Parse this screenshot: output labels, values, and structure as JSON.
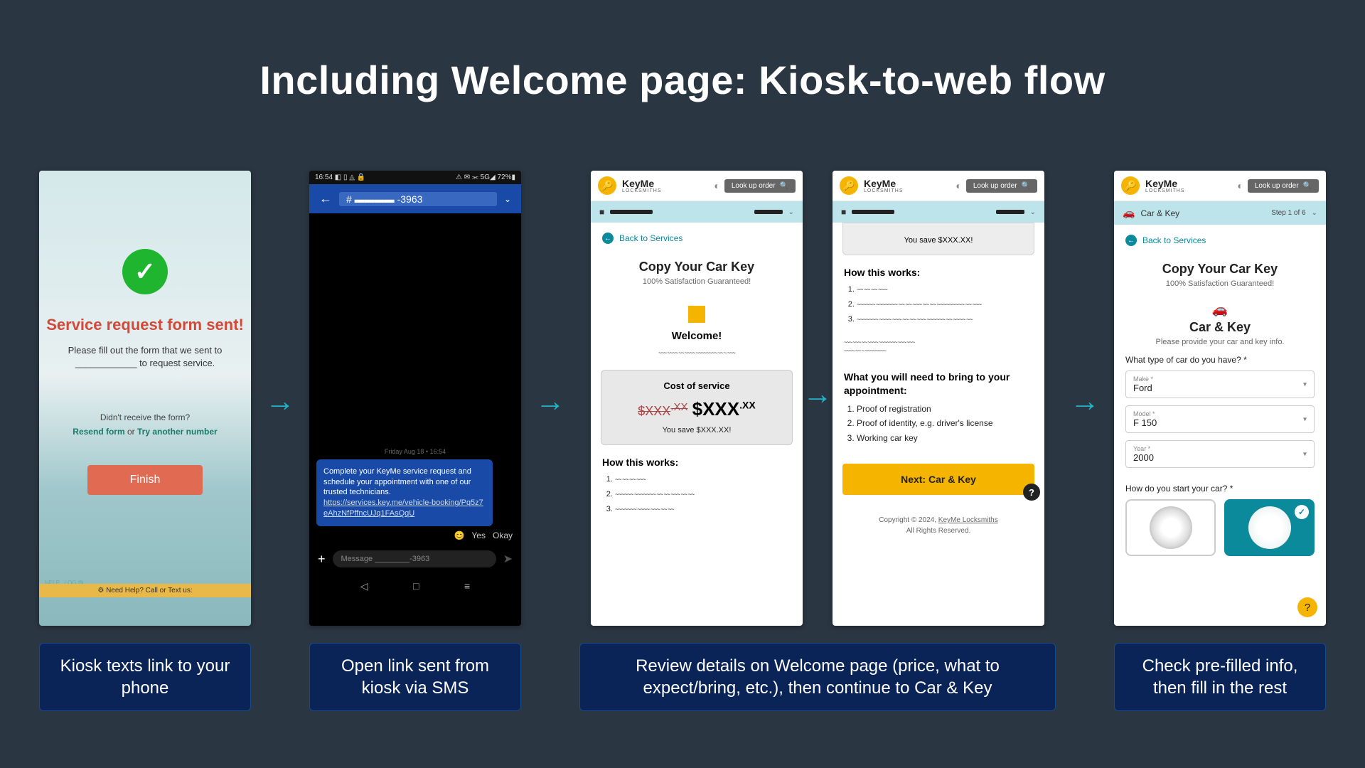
{
  "title": "Including Welcome page: Kiosk-to-web flow",
  "captions": {
    "s1": "Kiosk texts link to your phone",
    "s2": "Open link sent from kiosk via SMS",
    "s34": "Review details on Welcome page (price, what to expect/bring, etc.), then continue to Car & Key",
    "s5": "Check pre-filled info, then fill in the rest"
  },
  "kiosk": {
    "heading": "Service request form sent!",
    "para": "Please fill out the form that we sent to ____________ to request service.",
    "noreceive": "Didn't receive the form?",
    "resend": "Resend form",
    "or": " or ",
    "tryother": "Try another number",
    "finish": "Finish",
    "help": "HELP",
    "login": "LOG IN",
    "needhelp": "⚙ Need Help? Call or Text us:"
  },
  "sms": {
    "status_left": "16:54 ◧ ▯ ◬ 🔒",
    "status_right": "⚠ ✉ ⫘ 5G◢ 72%▮",
    "number": "-3963",
    "date": "Friday Aug 18 • 16:54",
    "bubble_text": "Complete your KeyMe service request and schedule your appointment with one of our trusted technicians.",
    "bubble_url": "https://services.key.me/vehicle-booking/Pq5z7eAhzNfPffncUJq1FAsQqU",
    "reply_yes": "Yes",
    "reply_okay": "Okay",
    "placeholder": "Message ________-3963"
  },
  "web": {
    "brand": "KeyMe",
    "brand_sub": "LOCKSMITHS",
    "lookup": "Look up order",
    "back": "Back to Services",
    "copy_title": "Copy Your Car Key",
    "satisfaction": "100% Satisfaction Guaranteed!",
    "welcome": "Welcome!",
    "cost_h": "Cost of service",
    "price_old": "$XXX",
    "price_old_sup": ".XX",
    "price_new": "$XXX",
    "price_new_sup": ".XX",
    "save": "You save $XXX.XX!",
    "how": "How this works:",
    "bring_h": "What you will need to bring to your appointment:",
    "bring1": "Proof of registration",
    "bring2": "Proof of identity, e.g. driver's license",
    "bring3": "Working car key",
    "next": "Next: Car & Key",
    "copy1": "Copyright © 2024, ",
    "copy2": "KeyMe Locksmiths",
    "copy3": "All Rights Reserved."
  },
  "form": {
    "subbar": "Car & Key",
    "step": "Step 1 of 6",
    "section": "Car & Key",
    "section_sub": "Please provide your car and key info.",
    "q1": "What type of car do you have? *",
    "make_l": "Make *",
    "make_v": "Ford",
    "model_l": "Model *",
    "model_v": "F 150",
    "year_l": "Year *",
    "year_v": "2000",
    "q2": "How do you start your car? *"
  }
}
